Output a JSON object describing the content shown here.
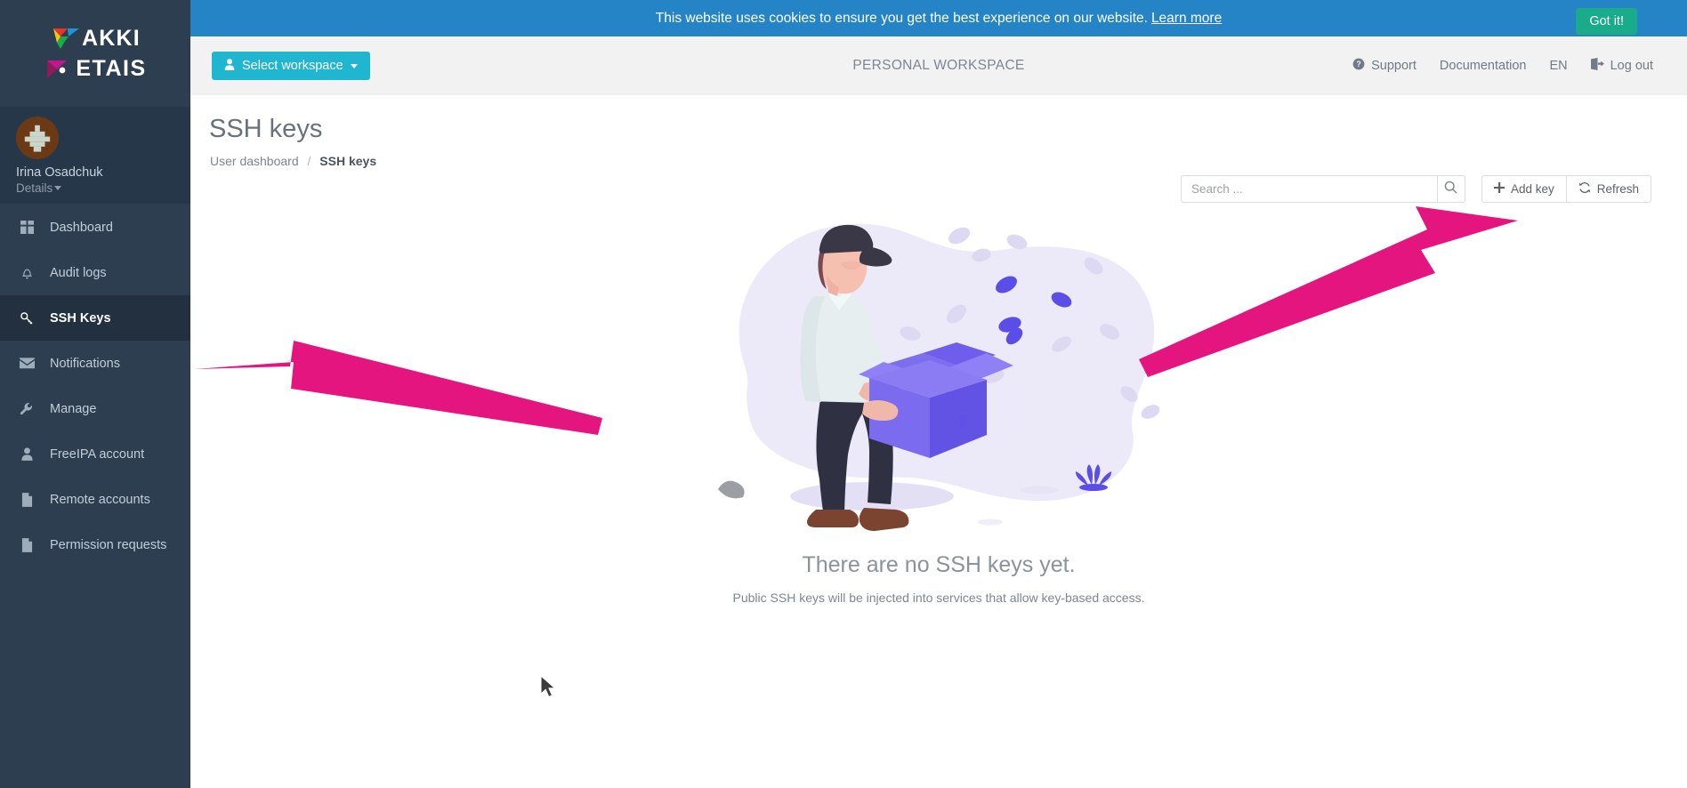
{
  "brand": {
    "logo_line1": "AKKI",
    "logo_line2": "ETAIS",
    "colors": {
      "sidebar": "#2c3e50",
      "sidebar_active": "#22303f",
      "cookie_bar": "#2484c6",
      "got_it_green": "#1aab8b",
      "workspace_cyan": "#21b6cf",
      "annotation_pink": "#e5157f"
    }
  },
  "cookie": {
    "message": "This website uses cookies to ensure you get the best experience on our website.",
    "learn_more": "Learn more",
    "accept_label": "Got it!"
  },
  "header": {
    "workspace_button": "Select workspace",
    "workspace_title": "PERSONAL WORKSPACE",
    "links": [
      {
        "label": "Support",
        "icon": "question-circle-icon"
      },
      {
        "label": "Documentation",
        "icon": ""
      },
      {
        "label": "EN",
        "icon": ""
      },
      {
        "label": "Log out",
        "icon": "logout-icon"
      }
    ]
  },
  "user": {
    "name": "Irina Osadchuk",
    "details_label": "Details"
  },
  "sidebar": {
    "items": [
      {
        "label": "Dashboard",
        "icon": "grid-icon",
        "active": false
      },
      {
        "label": "Audit logs",
        "icon": "bell-icon",
        "active": false
      },
      {
        "label": "SSH Keys",
        "icon": "key-icon",
        "active": true
      },
      {
        "label": "Notifications",
        "icon": "envelope-icon",
        "active": false
      },
      {
        "label": "Manage",
        "icon": "wrench-icon",
        "active": false
      },
      {
        "label": "FreeIPA account",
        "icon": "user-icon",
        "active": false
      },
      {
        "label": "Remote accounts",
        "icon": "document-icon",
        "active": false
      },
      {
        "label": "Permission requests",
        "icon": "document-icon",
        "active": false
      }
    ]
  },
  "page": {
    "title": "SSH keys",
    "breadcrumb_parent": "User dashboard",
    "breadcrumb_separator": "/",
    "breadcrumb_current": "SSH keys"
  },
  "toolbar": {
    "search_placeholder": "Search ...",
    "search_value": "",
    "search_icon": "search-icon",
    "add_key_label": "Add key",
    "add_key_icon": "plus-icon",
    "refresh_label": "Refresh",
    "refresh_icon": "refresh-icon"
  },
  "empty_state": {
    "title": "There are no SSH keys yet.",
    "subtitle": "Public SSH keys will be injected into services that allow key-based access.",
    "illustration": "person-holding-open-box-with-falling-leaves"
  }
}
